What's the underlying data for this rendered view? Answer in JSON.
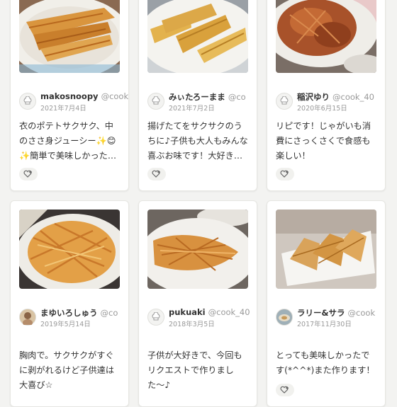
{
  "cards": [
    {
      "username": "makosnoopy",
      "cook_id": "@cook_",
      "date": "2021年7月4日",
      "text": "衣のポテトサクサク、中のささ身ジューシー✨😊✨簡単で美味しかった…"
    },
    {
      "username": "みぃたろーまま",
      "cook_id": "@co",
      "date": "2021年7月2日",
      "text": "揚げたてをサクサクのうちに♪子供も大人もみんな喜ぶお味です！大好き…"
    },
    {
      "username": "稲沢ゆり",
      "cook_id": "@cook_40",
      "date": "2020年6月15日",
      "text": "リピです！じゃがいも消費にさっくさくで食感も楽しい！"
    },
    {
      "username": "まゆいろしゅう",
      "cook_id": "@co",
      "date": "2019年5月14日",
      "text": "胸肉で。サクサクがすぐに剥がれるけど子供達は大喜び☆"
    },
    {
      "username": "pukuaki",
      "cook_id": "@cook_40",
      "date": "2018年3月5日",
      "text": "子供が大好きで、今回もリクエストで作りました〜♪"
    },
    {
      "username": "ラリー&サラ",
      "cook_id": "@cook",
      "date": "2017年11月30日",
      "text": "とっても美味しかったです(*^^*)また作ります！"
    }
  ],
  "icons": {
    "avatar_default": "chef-hat-icon",
    "tsukurepo": "heart-plus-icon"
  }
}
